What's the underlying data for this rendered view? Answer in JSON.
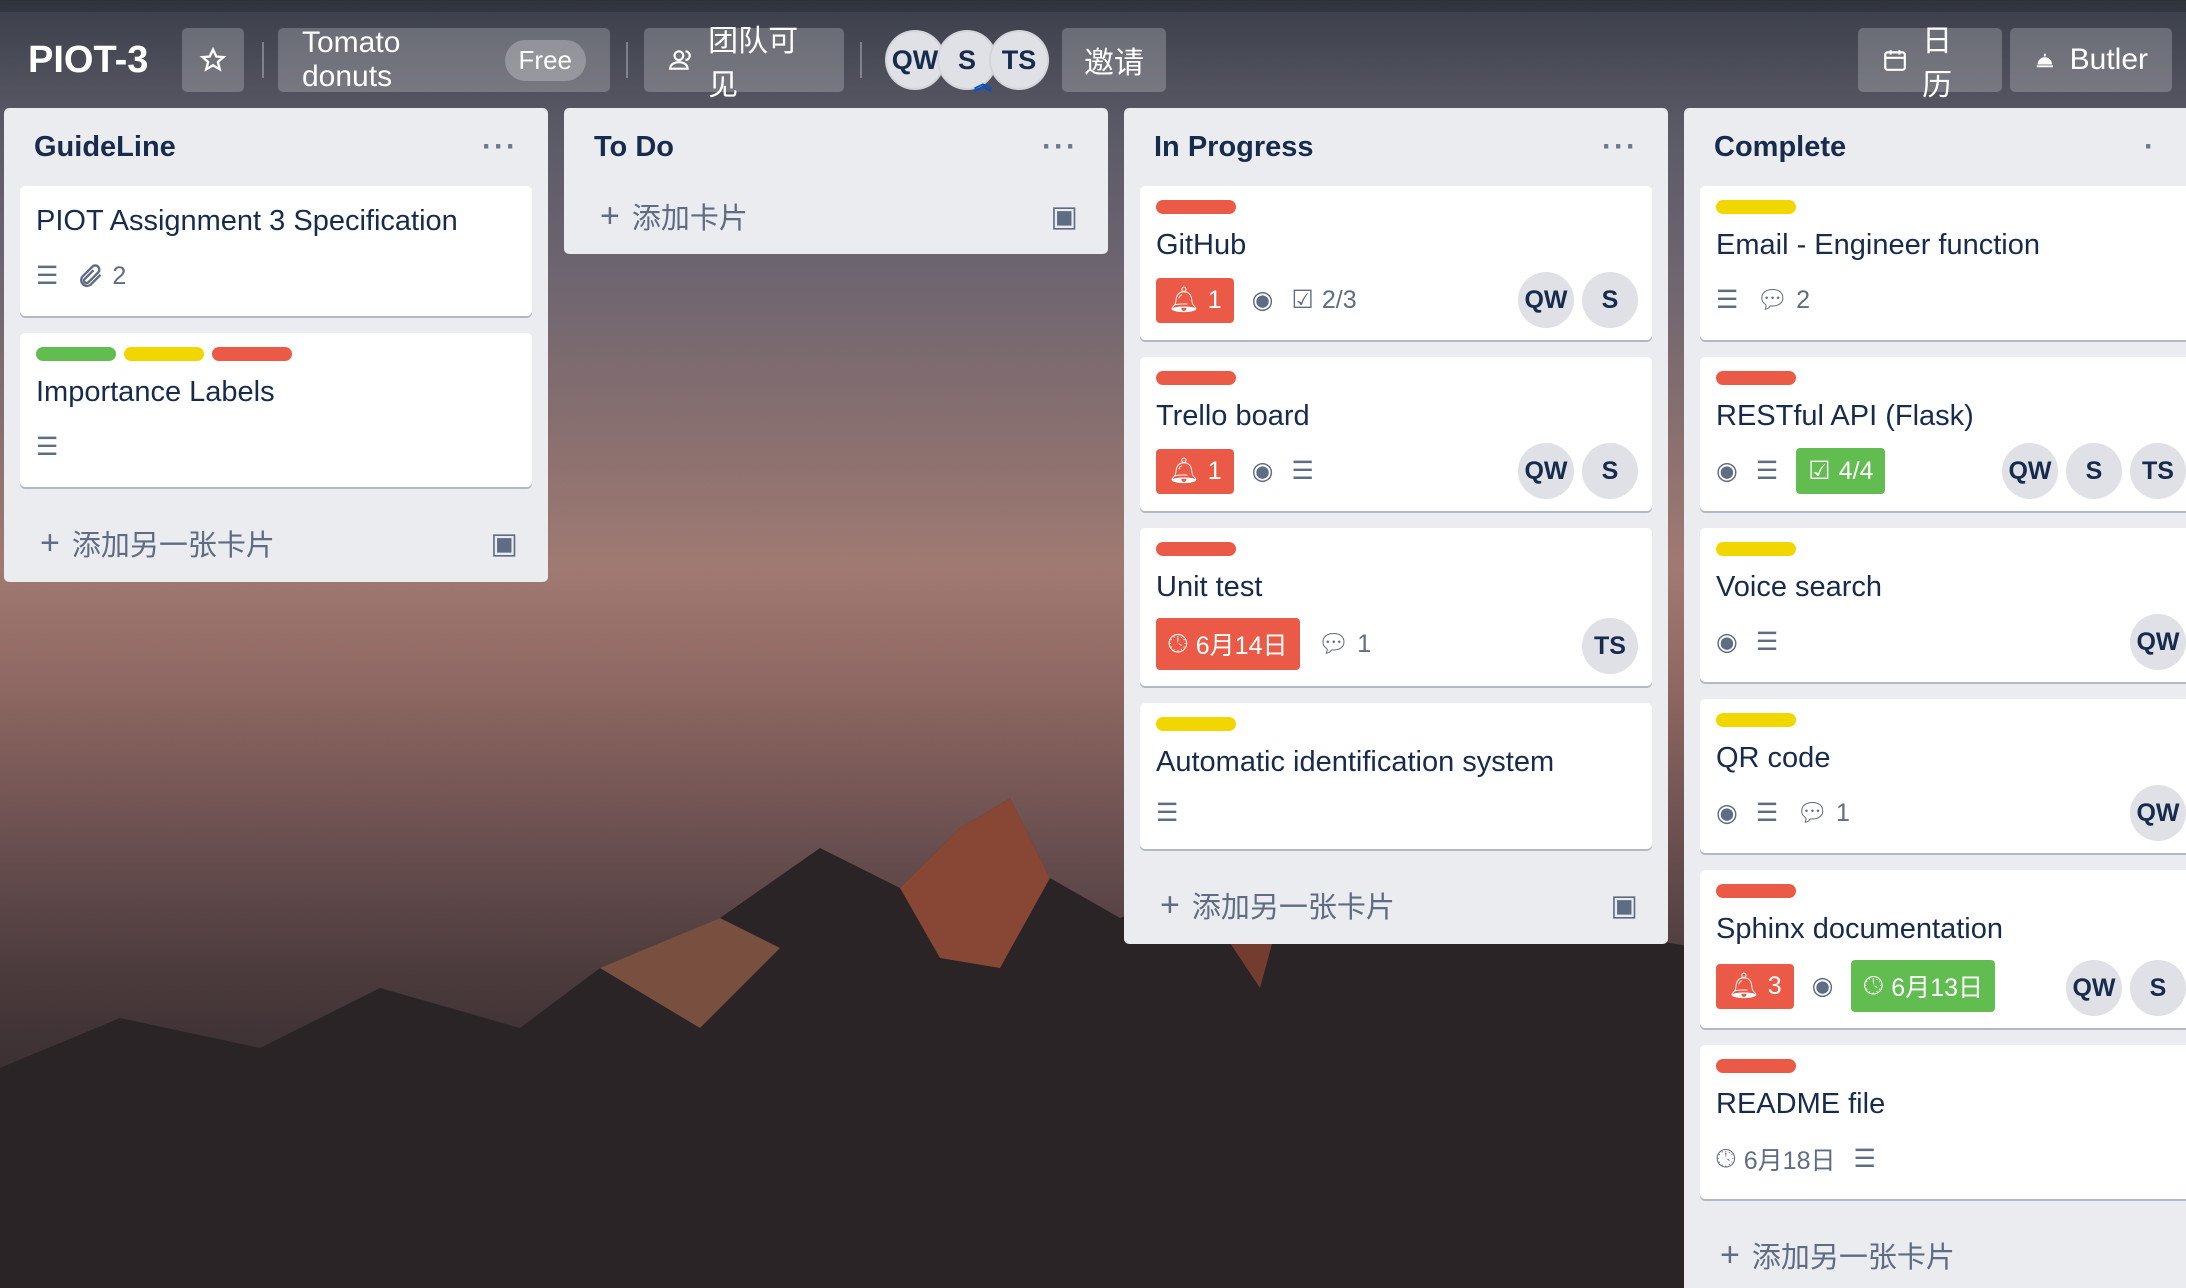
{
  "header": {
    "board_title": "PIOT-3",
    "team_name": "Tomato donuts",
    "team_plan": "Free",
    "visibility": "团队可见",
    "members": [
      "QW",
      "S",
      "TS"
    ],
    "invite": "邀请",
    "calendar": "日历",
    "butler": "Butler"
  },
  "lists": {
    "guideline": {
      "title": "GuideLine",
      "cards": [
        {
          "title": "PIOT Assignment 3 Specification",
          "attachments": "2"
        },
        {
          "title": "Importance Labels"
        }
      ],
      "add": "添加另一张卡片"
    },
    "todo": {
      "title": "To Do",
      "add": "添加卡片"
    },
    "inprogress": {
      "title": "In Progress",
      "cards": [
        {
          "title": "GitHub",
          "notifications": "1",
          "checklist": "2/3",
          "members": [
            "QW",
            "S"
          ]
        },
        {
          "title": "Trello board",
          "notifications": "1",
          "members": [
            "QW",
            "S"
          ]
        },
        {
          "title": "Unit test",
          "due": "6月14日",
          "comments": "1",
          "members": [
            "TS"
          ]
        },
        {
          "title": "Automatic identification system"
        }
      ],
      "add": "添加另一张卡片"
    },
    "complete": {
      "title": "Complete",
      "cards": [
        {
          "title": "Email - Engineer function",
          "comments": "2"
        },
        {
          "title": "RESTful API (Flask)",
          "checklist": "4/4",
          "members": [
            "QW",
            "S",
            "TS"
          ]
        },
        {
          "title": "Voice search",
          "members": [
            "QW"
          ]
        },
        {
          "title": "QR code",
          "comments": "1",
          "members": [
            "QW"
          ]
        },
        {
          "title": "Sphinx documentation",
          "notifications": "3",
          "due": "6月13日",
          "members": [
            "QW",
            "S"
          ]
        },
        {
          "title": "README file",
          "due": "6月18日"
        }
      ],
      "add": "添加另一张卡片"
    }
  },
  "colors": {
    "label_green": "#61bd4f",
    "label_yellow": "#f2d600",
    "label_red": "#eb5a46"
  }
}
